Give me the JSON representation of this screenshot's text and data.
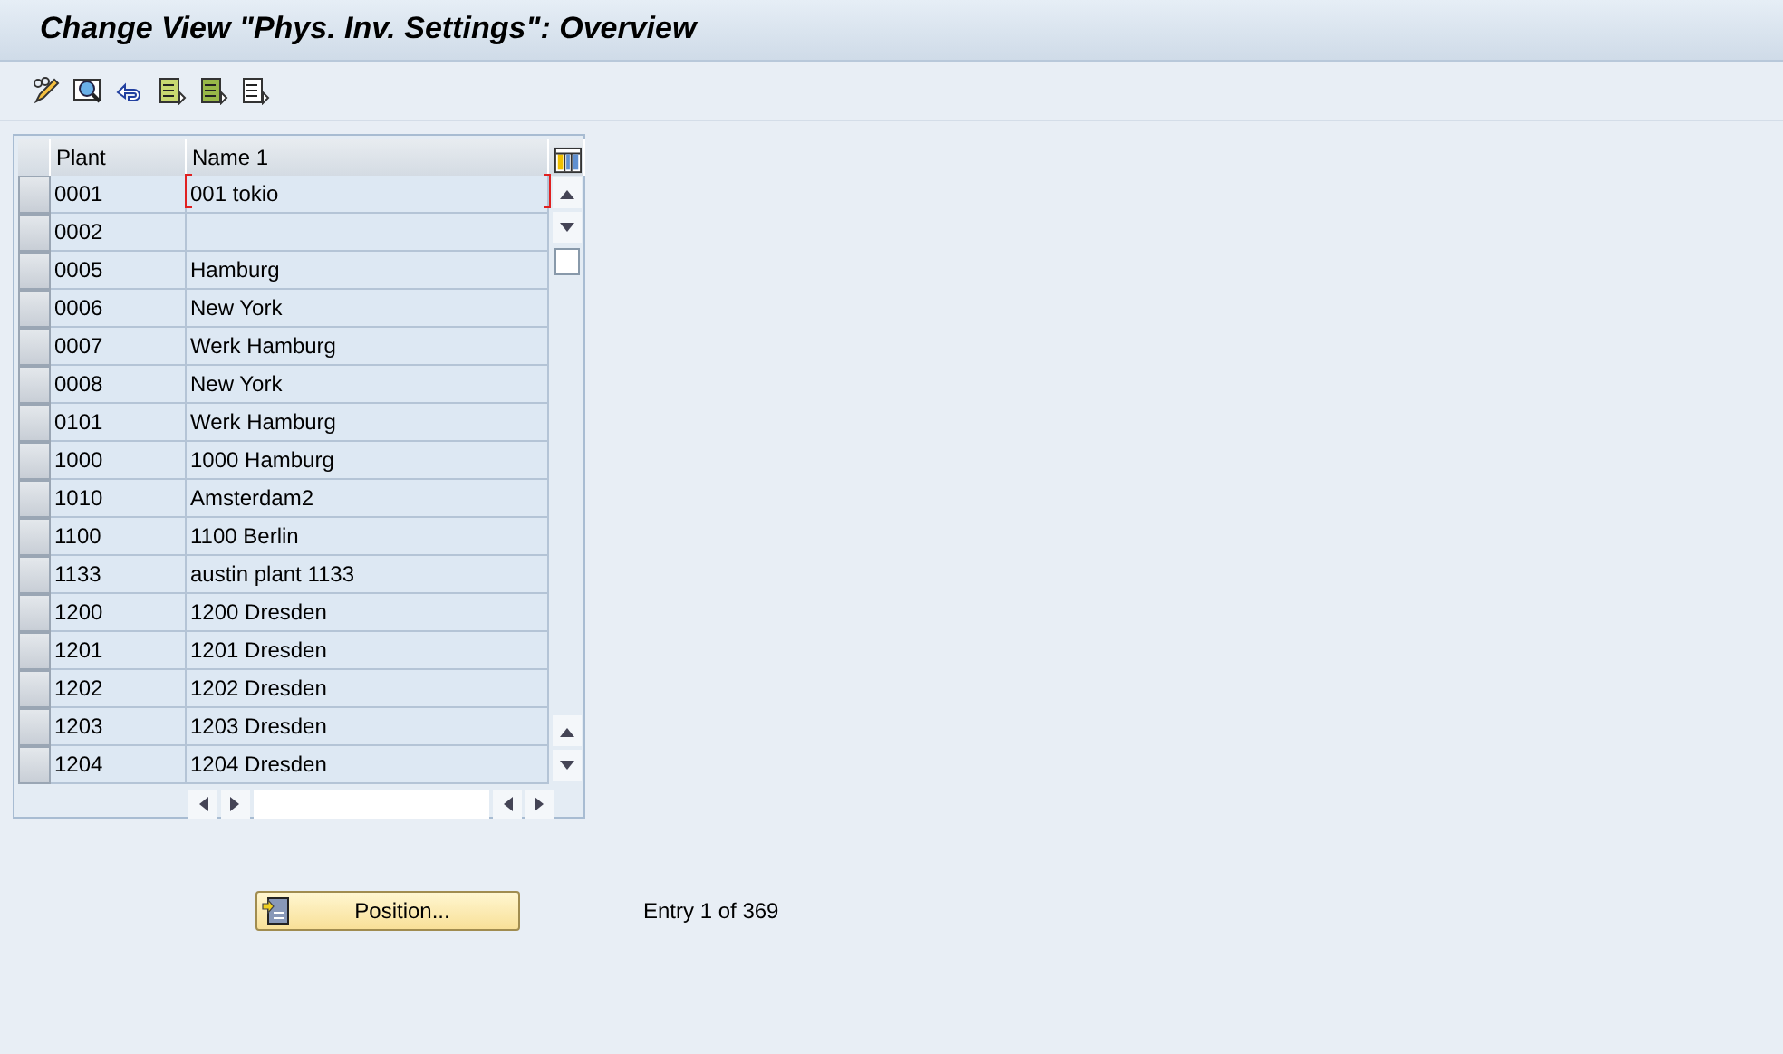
{
  "window": {
    "title": "Change View \"Phys. Inv. Settings\": Overview"
  },
  "table": {
    "columns": [
      "Plant",
      "Name 1"
    ],
    "rows": [
      {
        "plant": "0001",
        "name": "001 tokio",
        "focused": true
      },
      {
        "plant": "0002",
        "name": "",
        "focused": false
      },
      {
        "plant": "0005",
        "name": "Hamburg",
        "focused": false
      },
      {
        "plant": "0006",
        "name": "New York",
        "focused": false
      },
      {
        "plant": "0007",
        "name": "Werk Hamburg",
        "focused": false
      },
      {
        "plant": "0008",
        "name": "New York",
        "focused": false
      },
      {
        "plant": "0101",
        "name": "Werk Hamburg",
        "focused": false
      },
      {
        "plant": "1000",
        "name": "1000 Hamburg",
        "focused": false
      },
      {
        "plant": "1010",
        "name": "Amsterdam2",
        "focused": false
      },
      {
        "plant": "1100",
        "name": "1100 Berlin",
        "focused": false
      },
      {
        "plant": "1133",
        "name": "austin plant 1133",
        "focused": false
      },
      {
        "plant": "1200",
        "name": "1200 Dresden",
        "focused": false
      },
      {
        "plant": "1201",
        "name": "1201 Dresden",
        "focused": false
      },
      {
        "plant": "1202",
        "name": "1202 Dresden",
        "focused": false
      },
      {
        "plant": "1203",
        "name": "1203 Dresden",
        "focused": false
      },
      {
        "plant": "1204",
        "name": "1204 Dresden",
        "focused": false
      }
    ]
  },
  "footer": {
    "button": "Position...",
    "entry": "Entry 1 of 369"
  }
}
